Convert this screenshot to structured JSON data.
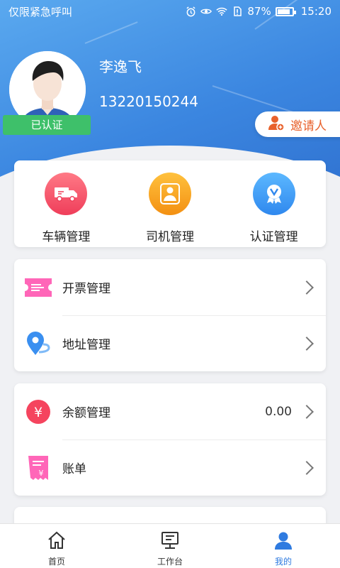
{
  "status_bar": {
    "carrier": "仅限紧急呼叫",
    "battery": "87%",
    "time": "15:20"
  },
  "profile": {
    "name": "李逸飞",
    "phone": "13220150244",
    "verified_badge": "已认证"
  },
  "invite_button": "邀请人",
  "quick_actions": [
    {
      "label": "车辆管理",
      "icon": "truck-icon",
      "color": "#f2536a"
    },
    {
      "label": "司机管理",
      "icon": "driver-icon",
      "color": "#f4a019"
    },
    {
      "label": "认证管理",
      "icon": "certificate-icon",
      "color": "#3a9bf0"
    }
  ],
  "menu_group_1": [
    {
      "label": "开票管理",
      "icon": "ticket-icon"
    },
    {
      "label": "地址管理",
      "icon": "location-pin-icon"
    }
  ],
  "menu_group_2": [
    {
      "label": "余额管理",
      "icon": "yuan-coin-icon",
      "value": "0.00"
    },
    {
      "label": "账单",
      "icon": "bill-icon"
    }
  ],
  "tab_bar": [
    {
      "label": "首页",
      "icon": "home-icon"
    },
    {
      "label": "工作台",
      "icon": "workbench-icon"
    },
    {
      "label": "我的",
      "icon": "user-icon",
      "active": true
    }
  ],
  "colors": {
    "header_blue": "#3b86e0",
    "verified_green": "#3ec06a",
    "invite_orange": "#e8612c",
    "active_tab": "#2f7be0"
  }
}
